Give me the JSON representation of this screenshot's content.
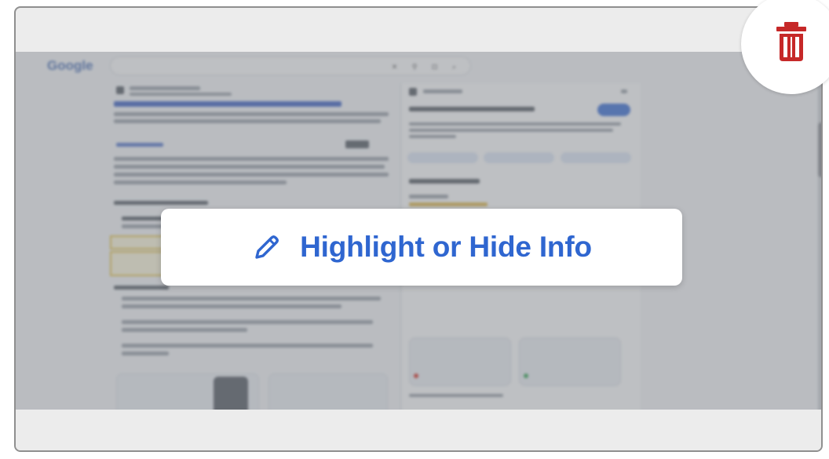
{
  "overlay": {
    "label": "Highlight or Hide Info",
    "icon": "pencil-icon",
    "accent_color": "#2f66d0"
  },
  "actions": {
    "delete_icon": "trash-icon",
    "delete_color": "#c62828"
  },
  "background_screenshot": {
    "logo_text": "Google"
  }
}
